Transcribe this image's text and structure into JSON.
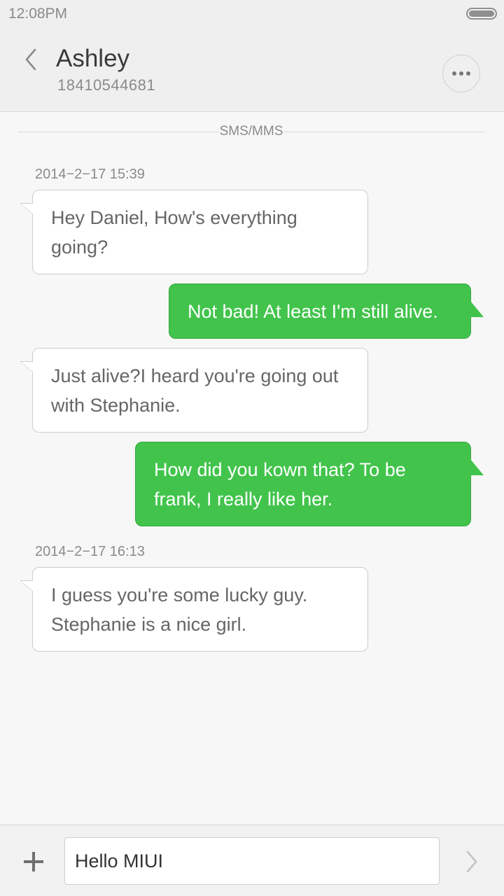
{
  "status_bar": {
    "time": "12:08PM"
  },
  "header": {
    "contact_name": "Ashley",
    "contact_number": "18410544681",
    "back_icon": "chevron-left-icon",
    "more_icon": "more-dots-icon"
  },
  "conversation": {
    "channel_label": "SMS/MMS",
    "timestamps": [
      "2014−2−17 15:39",
      "2014−2−17 16:13"
    ],
    "messages": [
      {
        "direction": "incoming",
        "text": "Hey Daniel, How's everything going?"
      },
      {
        "direction": "outgoing",
        "text": "Not bad! At least I'm still alive."
      },
      {
        "direction": "incoming",
        "text": "Just  alive?I heard you're going out with Stephanie."
      },
      {
        "direction": "outgoing",
        "text": "How did you kown that? To be frank, I really like her."
      },
      {
        "direction": "incoming",
        "text": "I guess you're some lucky guy. Stephanie is a nice girl."
      }
    ]
  },
  "composer": {
    "value": "Hello MIUI",
    "add_icon": "plus-icon",
    "send_icon": "chevron-right-icon"
  },
  "colors": {
    "outgoing_bubble": "#42c44c",
    "incoming_bubble": "#ffffff",
    "header_background": "#efefef",
    "chat_background": "#f7f7f7"
  }
}
